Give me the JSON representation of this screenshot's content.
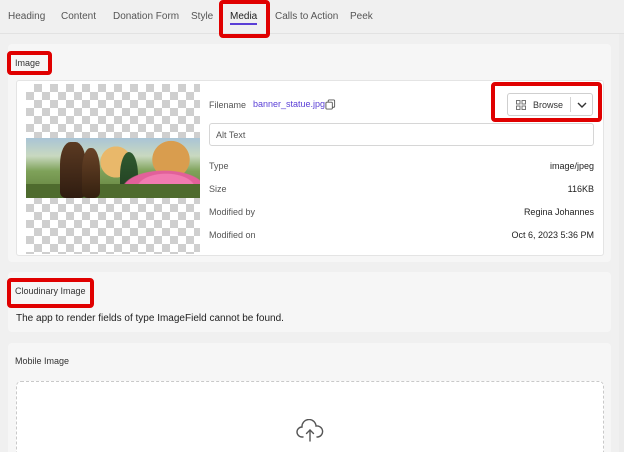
{
  "tabs": [
    {
      "label": "Heading"
    },
    {
      "label": "Content"
    },
    {
      "label": "Donation Form"
    },
    {
      "label": "Style"
    },
    {
      "label": "Media"
    },
    {
      "label": "Calls to Action"
    },
    {
      "label": "Peek"
    }
  ],
  "active_tab": "Media",
  "image_section": {
    "title": "Image",
    "filename_label": "Filename",
    "filename": "banner_statue.jpg",
    "browse_label": "Browse",
    "alt_placeholder": "Alt Text",
    "meta": [
      {
        "key": "Type",
        "value": "image/jpeg"
      },
      {
        "key": "Size",
        "value": "116KB"
      },
      {
        "key": "Modified by",
        "value": "Regina Johannes"
      },
      {
        "key": "Modified on",
        "value": "Oct 6, 2023 5:36 PM"
      }
    ]
  },
  "cloudinary_section": {
    "title": "Cloudinary Image",
    "message": "The app to render fields of type ImageField cannot be found."
  },
  "mobile_section": {
    "title": "Mobile Image"
  },
  "colors": {
    "accent": "#5a3fd6",
    "highlight": "#e00000"
  },
  "icons": {
    "copy": "copy-icon",
    "browse": "grid-icon",
    "dropdown": "chevron-down-icon",
    "upload": "cloud-upload-icon"
  }
}
